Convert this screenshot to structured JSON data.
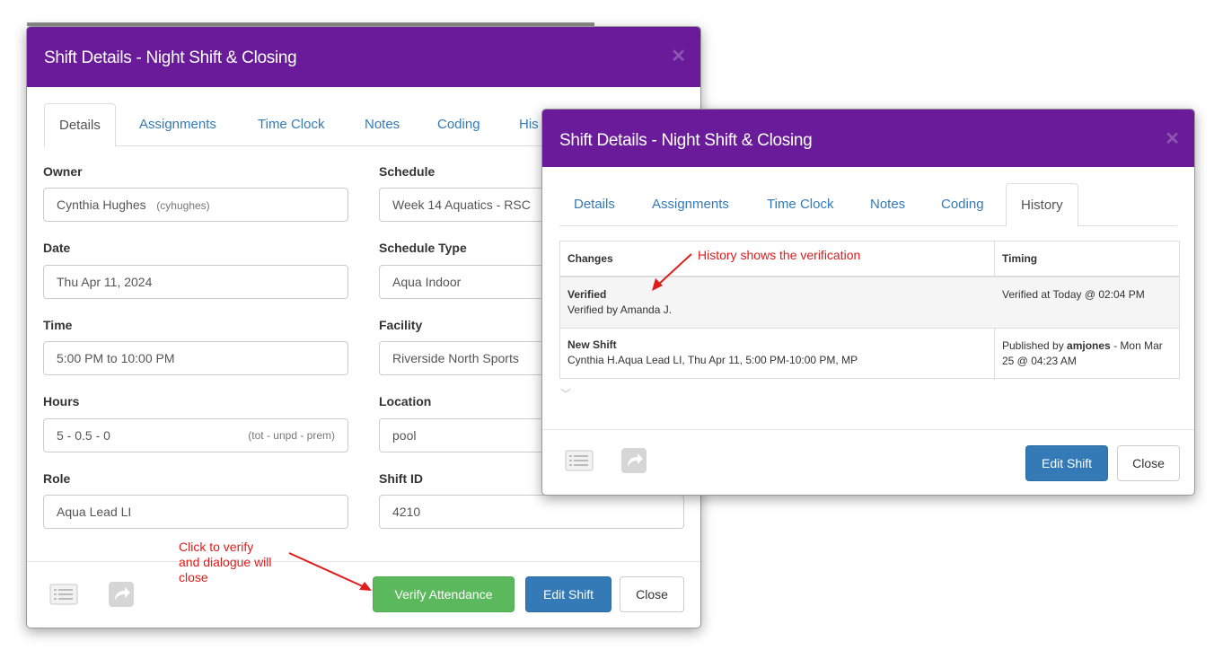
{
  "modal1": {
    "title": "Shift Details - Night Shift & Closing",
    "tabs": [
      "Details",
      "Assignments",
      "Time Clock",
      "Notes",
      "Coding",
      "His"
    ],
    "fields": {
      "owner_label": "Owner",
      "owner_value": "Cynthia Hughes",
      "owner_hint": "(cyhughes)",
      "schedule_label": "Schedule",
      "schedule_value": "Week 14 Aquatics - RSC",
      "date_label": "Date",
      "date_value": "Thu Apr 11, 2024",
      "schedule_type_label": "Schedule Type",
      "schedule_type_value": "Aqua Indoor",
      "time_label": "Time",
      "time_value": "5:00 PM to 10:00 PM",
      "facility_label": "Facility",
      "facility_value": "Riverside North Sports",
      "hours_label": "Hours",
      "hours_value": "5 - 0.5 - 0",
      "hours_hint": "(tot - unpd - prem)",
      "location_label": "Location",
      "location_value": "pool",
      "role_label": "Role",
      "role_value": "Aqua Lead LI",
      "shift_id_label": "Shift ID",
      "shift_id_value": "4210"
    },
    "buttons": {
      "verify": "Verify Attendance",
      "edit": "Edit Shift",
      "close": "Close"
    }
  },
  "modal2": {
    "title": "Shift Details - Night Shift & Closing",
    "tabs": [
      "Details",
      "Assignments",
      "Time Clock",
      "Notes",
      "Coding",
      "History"
    ],
    "history": {
      "col_changes": "Changes",
      "col_timing": "Timing",
      "rows": [
        {
          "title": "Verified",
          "detail": "Verified by Amanda J.",
          "timing": "Verified at Today @ 02:04 PM"
        },
        {
          "title": "New Shift",
          "detail": "Cynthia H.Aqua Lead LI, Thu Apr 11, 5:00 PM-10:00 PM, MP",
          "timing_pre": "Published by ",
          "timing_user": "amjones",
          "timing_post": " - Mon Mar 25 @ 04:23 AM"
        }
      ]
    },
    "buttons": {
      "edit": "Edit Shift",
      "close": "Close"
    }
  },
  "annotations": {
    "history_note": "History shows the verification",
    "verify_note_1": "Click to verify",
    "verify_note_2": "and dialogue will",
    "verify_note_3": "close"
  },
  "colors": {
    "header": "#6a1b9a",
    "link": "#337ab7",
    "verify": "#5cb85c",
    "annotation": "#e01b1b"
  },
  "icons": [
    "close-icon",
    "list-icon",
    "share-icon",
    "chevron-down-icon",
    "arrow-icon"
  ]
}
